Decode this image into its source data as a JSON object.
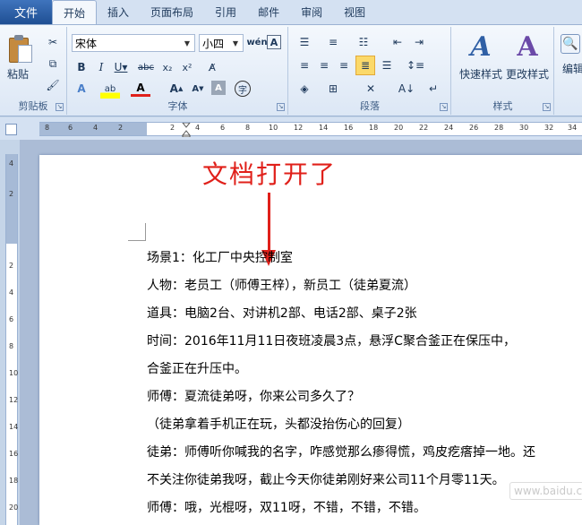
{
  "menu": {
    "file": "文件",
    "tabs": [
      "开始",
      "插入",
      "页面布局",
      "引用",
      "邮件",
      "审阅",
      "视图"
    ],
    "active": "开始"
  },
  "ribbon": {
    "clipboard": {
      "paste": "粘贴",
      "group": "剪贴板"
    },
    "font": {
      "name": "宋体",
      "size": "小四",
      "group": "字体"
    },
    "paragraph": {
      "group": "段落"
    },
    "styles": {
      "quick": "快速样式",
      "change": "更改样式",
      "group": "样式"
    },
    "editing": {
      "label": "编辑"
    }
  },
  "ruler": {
    "h_ticks": [
      "8",
      "6",
      "4",
      "2",
      "2",
      "4",
      "6",
      "8",
      "10",
      "12",
      "14",
      "16",
      "18",
      "20",
      "22",
      "24",
      "26",
      "28",
      "30",
      "32",
      "34"
    ],
    "v_ticks": [
      "4",
      "2",
      "2",
      "4",
      "6",
      "8",
      "10",
      "12",
      "14",
      "16",
      "18",
      "20"
    ]
  },
  "annotation": "文档打开了",
  "document": {
    "lines": [
      "场景1：化工厂中央控制室",
      "人物：老员工（师傅王梓），新员工（徒弟夏流）",
      "道具：电脑2台、对讲机2部、电话2部、桌子2张",
      "时间：2016年11月11日夜班凌晨3点，悬浮C聚合釜正在保压中，",
      "合釜正在升压中。",
      "师傅：夏流徒弟呀，你来公司多久了？",
      "（徒弟拿着手机正在玩，头都没抬伤心的回复）",
      "徒弟：师傅听你喊我的名字，咋感觉那么瘆得慌，鸡皮疙瘩掉一地。还",
      "不关注你徒弟我呀，截止今天你徒弟刚好来公司11个月零11天。",
      "师傅：哦，光棍呀，双11呀，不错，不错，不错。"
    ]
  },
  "watermark": "www.baidu.com"
}
